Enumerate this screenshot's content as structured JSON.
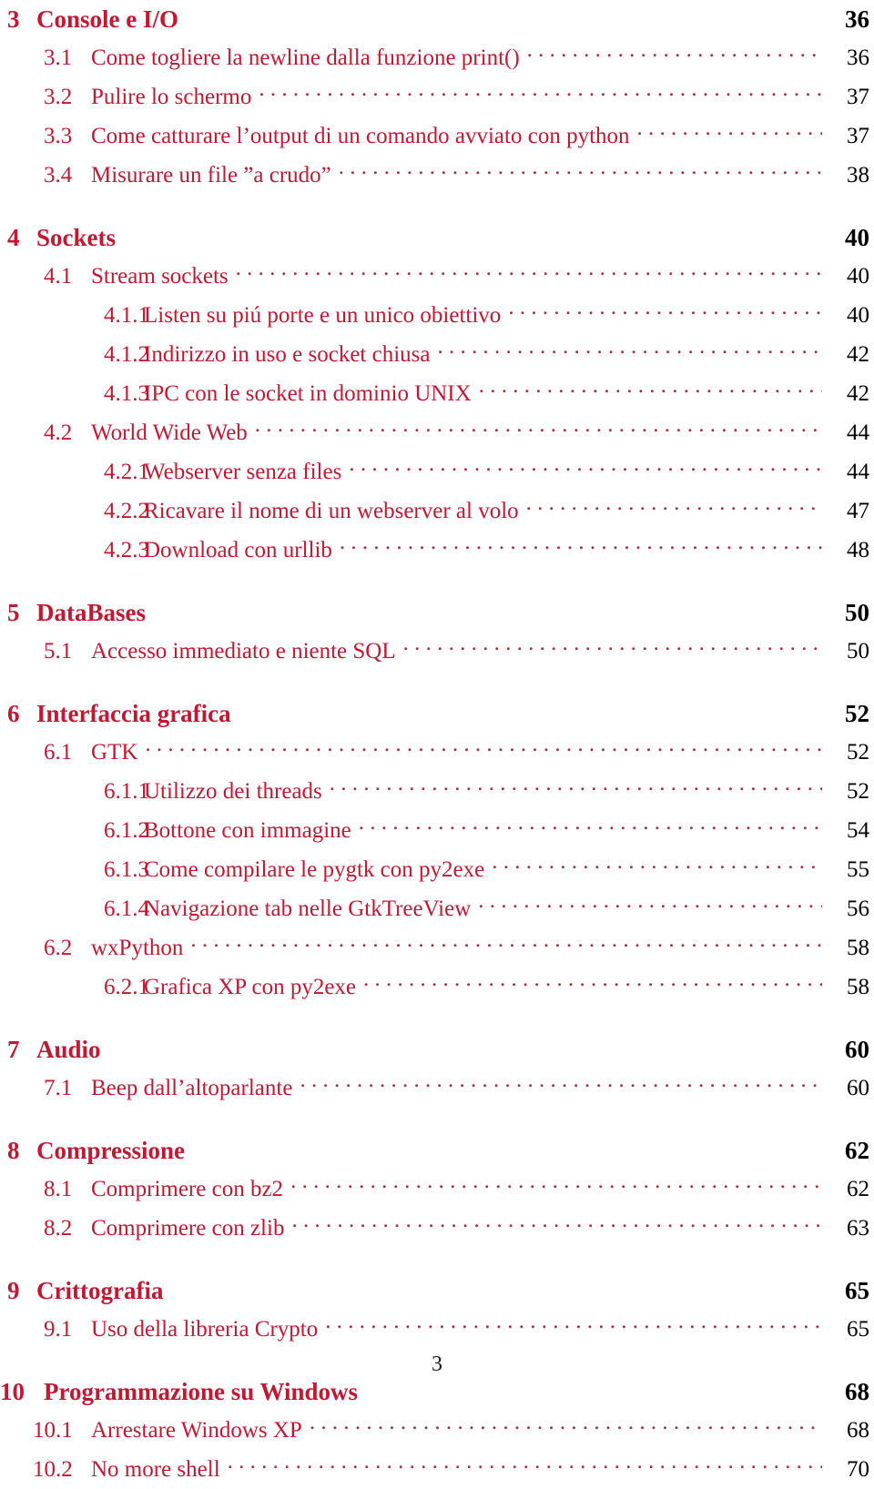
{
  "document": {
    "kind": "table-of-contents",
    "language": "it",
    "folio": "3"
  },
  "colors": {
    "heading_red": "#C31832",
    "entry_red": "#C31832",
    "leader_red": "#A8303C",
    "page_number_black": "#000000",
    "background": "#FFFFFF"
  },
  "entries": [
    {
      "level": "chapter",
      "number": "3",
      "title": "Console e I/O",
      "page": "36"
    },
    {
      "level": "section",
      "number": "3.1",
      "title": "Come togliere la newline dalla funzione print()",
      "page": "36"
    },
    {
      "level": "section",
      "number": "3.2",
      "title": "Pulire lo schermo",
      "page": "37"
    },
    {
      "level": "section",
      "number": "3.3",
      "title": "Come catturare l’output di un comando avviato con python",
      "page": "37"
    },
    {
      "level": "section",
      "number": "3.4",
      "title": "Misurare un file ”a crudo”",
      "page": "38"
    },
    {
      "level": "chapter",
      "number": "4",
      "title": "Sockets",
      "page": "40"
    },
    {
      "level": "section",
      "number": "4.1",
      "title": "Stream sockets",
      "page": "40"
    },
    {
      "level": "subsection",
      "number": "4.1.1",
      "title": "Listen su piú porte e un unico obiettivo",
      "page": "40"
    },
    {
      "level": "subsection",
      "number": "4.1.2",
      "title": "Indirizzo in uso e socket chiusa",
      "page": "42"
    },
    {
      "level": "subsection",
      "number": "4.1.3",
      "title": "IPC con le socket in dominio UNIX",
      "page": "42"
    },
    {
      "level": "section",
      "number": "4.2",
      "title": "World Wide Web",
      "page": "44"
    },
    {
      "level": "subsection",
      "number": "4.2.1",
      "title": "Webserver senza files",
      "page": "44"
    },
    {
      "level": "subsection",
      "number": "4.2.2",
      "title": "Ricavare il nome di un webserver al volo",
      "page": "47"
    },
    {
      "level": "subsection",
      "number": "4.2.3",
      "title": "Download con urllib",
      "page": "48"
    },
    {
      "level": "chapter",
      "number": "5",
      "title": "DataBases",
      "page": "50"
    },
    {
      "level": "section",
      "number": "5.1",
      "title": "Accesso immediato e niente SQL",
      "page": "50"
    },
    {
      "level": "chapter",
      "number": "6",
      "title": "Interfaccia grafica",
      "page": "52"
    },
    {
      "level": "section",
      "number": "6.1",
      "title": "GTK",
      "page": "52"
    },
    {
      "level": "subsection",
      "number": "6.1.1",
      "title": "Utilizzo dei threads",
      "page": "52"
    },
    {
      "level": "subsection",
      "number": "6.1.2",
      "title": "Bottone con immagine",
      "page": "54"
    },
    {
      "level": "subsection",
      "number": "6.1.3",
      "title": "Come compilare le pygtk con py2exe",
      "page": "55"
    },
    {
      "level": "subsection",
      "number": "6.1.4",
      "title": "Navigazione tab nelle GtkTreeView",
      "page": "56"
    },
    {
      "level": "section",
      "number": "6.2",
      "title": "wxPython",
      "page": "58"
    },
    {
      "level": "subsection",
      "number": "6.2.1",
      "title": "Grafica XP con py2exe",
      "page": "58"
    },
    {
      "level": "chapter",
      "number": "7",
      "title": "Audio",
      "page": "60"
    },
    {
      "level": "section",
      "number": "7.1",
      "title": "Beep dall’altoparlante",
      "page": "60"
    },
    {
      "level": "chapter",
      "number": "8",
      "title": "Compressione",
      "page": "62"
    },
    {
      "level": "section",
      "number": "8.1",
      "title": "Comprimere con bz2",
      "page": "62"
    },
    {
      "level": "section",
      "number": "8.2",
      "title": "Comprimere con zlib",
      "page": "63"
    },
    {
      "level": "chapter",
      "number": "9",
      "title": "Crittografia",
      "page": "65"
    },
    {
      "level": "section",
      "number": "9.1",
      "title": "Uso della libreria Crypto",
      "page": "65"
    },
    {
      "level": "chapter",
      "number": "10",
      "title": "Programmazione su Windows",
      "page": "68"
    },
    {
      "level": "section",
      "number": "10.1",
      "title": "Arrestare Windows XP",
      "page": "68"
    },
    {
      "level": "section",
      "number": "10.2",
      "title": "No more shell",
      "page": "70"
    }
  ]
}
